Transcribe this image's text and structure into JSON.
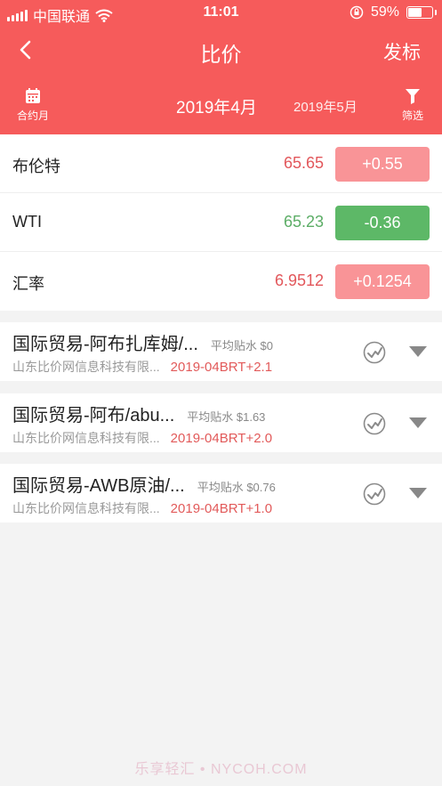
{
  "status_bar": {
    "carrier": "中国联通",
    "time": "11:01",
    "battery_percent": "59%",
    "battery_level": 0.59
  },
  "nav": {
    "title": "比价",
    "action": "发标"
  },
  "tabs": {
    "calendar_label": "合约月",
    "active_month": "2019年4月",
    "next_month": "2019年5月",
    "filter_label": "筛选"
  },
  "quotes": [
    {
      "name": "布伦特",
      "price": "65.65",
      "change": "+0.55",
      "direction": "up"
    },
    {
      "name": "WTI",
      "price": "65.23",
      "change": "-0.36",
      "direction": "down"
    },
    {
      "name": "汇率",
      "price": "6.9512",
      "change": "+0.1254",
      "direction": "up"
    }
  ],
  "colors": {
    "header": "#f65b5b",
    "up_text": "#e2575b",
    "up_bg": "#f99497",
    "down_text": "#5cad66",
    "down_bg": "#5db867"
  },
  "cards": [
    {
      "title": "国际贸易-阿布扎库姆/...",
      "premium": "平均贴水 $0",
      "company": "山东比价网信息科技有限...",
      "code": "2019-04BRT+2.1"
    },
    {
      "title": "国际贸易-阿布/abu...",
      "premium": "平均贴水 $1.63",
      "company": "山东比价网信息科技有限...",
      "code": "2019-04BRT+2.0"
    },
    {
      "title": "国际贸易-AWB原油/...",
      "premium": "平均贴水 $0.76",
      "company": "山东比价网信息科技有限...",
      "code": "2019-04BRT+1.0"
    }
  ],
  "watermark": "乐享轻汇 • NYCOH.COM"
}
